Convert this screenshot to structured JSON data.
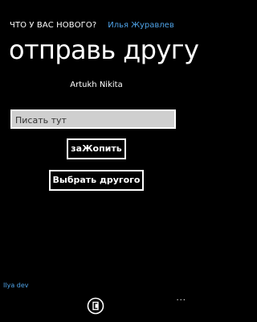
{
  "header": {
    "app_title": "ЧТО У ВАС НОВОГО?",
    "user_name": "Илья Журавлев",
    "user_name_color": "#4fa3e8"
  },
  "page": {
    "title": "отправь другу",
    "friend_name": "Artukh Nikita"
  },
  "form": {
    "message_placeholder": "Писать тут",
    "message_value": ""
  },
  "buttons": {
    "save_label": "заЖопить",
    "pick_label": "Выбрать другого"
  },
  "footer": {
    "author": "Ilya dev",
    "author_color": "#4fa3e8",
    "appbar_icon": "share-icon",
    "more_label": "..."
  }
}
